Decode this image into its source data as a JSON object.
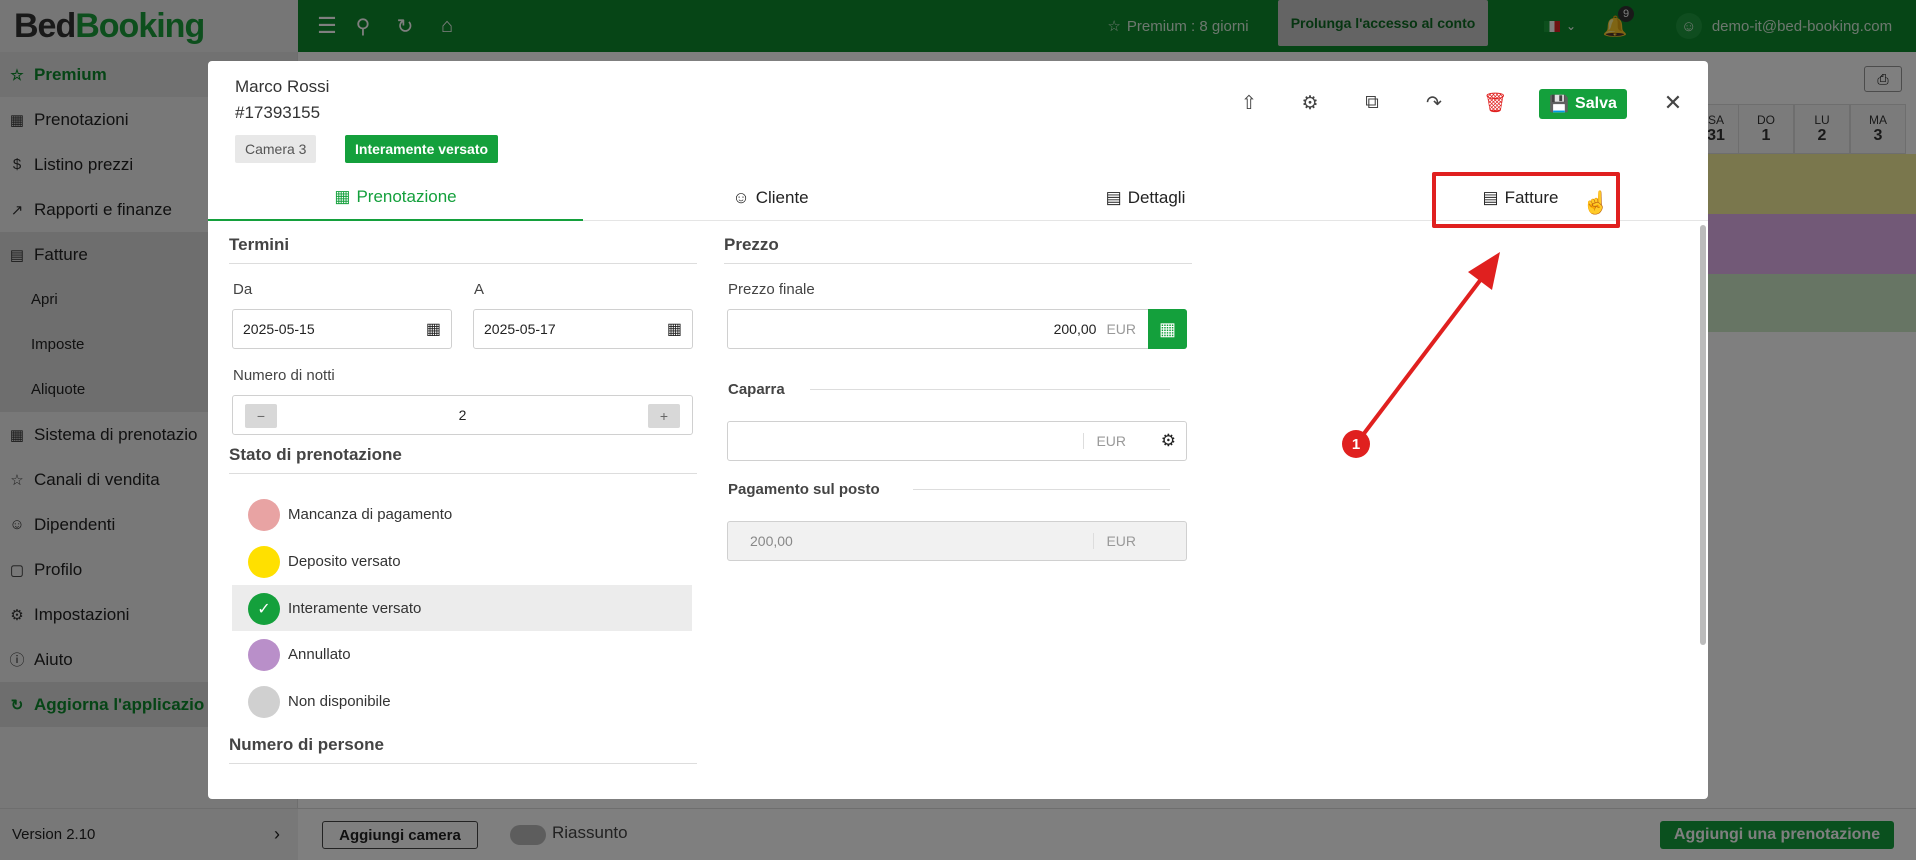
{
  "app": {
    "logo_part1": "Bed",
    "logo_part2": "Booking"
  },
  "topbar": {
    "premium_label": "Premium : 8 giorni",
    "extend_button": "Prolunga l'accesso al conto",
    "notifications_count": "9",
    "user_email": "demo-it@bed-booking.com"
  },
  "sidebar": {
    "items": [
      {
        "label": "Premium",
        "icon": "star-icon"
      },
      {
        "label": "Prenotazioni",
        "icon": "calendar-icon"
      },
      {
        "label": "Listino prezzi",
        "icon": "dollar-icon"
      },
      {
        "label": "Rapporti e finanze",
        "icon": "chart-icon"
      },
      {
        "label": "Fatture",
        "icon": "invoice-icon"
      },
      {
        "label": "Apri"
      },
      {
        "label": "Imposte"
      },
      {
        "label": "Aliquote"
      },
      {
        "label": "Sistema di prenotazio",
        "icon": "grid-icon"
      },
      {
        "label": "Canali di vendita",
        "icon": "star-outline-icon"
      },
      {
        "label": "Dipendenti",
        "icon": "user-plus-icon"
      },
      {
        "label": "Profilo",
        "icon": "building-icon"
      },
      {
        "label": "Impostazioni",
        "icon": "gear-icon"
      },
      {
        "label": "Aiuto",
        "icon": "info-icon"
      },
      {
        "label": "Aggiorna l'applicazio",
        "icon": "refresh-icon"
      }
    ],
    "version": "Version 2.10"
  },
  "calendar": {
    "days": [
      {
        "dow": "SA",
        "num": "31"
      },
      {
        "dow": "DO",
        "num": "1"
      },
      {
        "dow": "LU",
        "num": "2"
      },
      {
        "dow": "MA",
        "num": "3"
      }
    ]
  },
  "bottombar": {
    "add_room": "Aggiungi camera",
    "summary": "Riassunto",
    "add_booking": "Aggiungi una prenotazione"
  },
  "modal": {
    "guest_name": "Marco Rossi",
    "booking_id": "#17393155",
    "room_tag": "Camera 3",
    "status_tag": "Interamente versato",
    "save_label": "Salva",
    "tabs": [
      {
        "label": "Prenotazione"
      },
      {
        "label": "Cliente"
      },
      {
        "label": "Dettagli"
      },
      {
        "label": "Fatture"
      }
    ],
    "terms": {
      "title": "Termini",
      "from_label": "Da",
      "from_value": "2025-05-15",
      "to_label": "A",
      "to_value": "2025-05-17",
      "nights_label": "Numero di notti",
      "nights_value": "2"
    },
    "status_section": {
      "title": "Stato di prenotazione",
      "options": [
        {
          "label": "Mancanza di pagamento",
          "color": "#e8a3a3"
        },
        {
          "label": "Deposito versato",
          "color": "#ffe000"
        },
        {
          "label": "Interamente versato",
          "color": "#14a03c"
        },
        {
          "label": "Annullato",
          "color": "#b98fc9"
        },
        {
          "label": "Non disponibile",
          "color": "#d0d0d0"
        }
      ]
    },
    "persons_title": "Numero di persone",
    "price": {
      "title": "Prezzo",
      "final_label": "Prezzo finale",
      "final_value": "200,00",
      "currency": "EUR",
      "deposit_label": "Caparra",
      "deposit_value": "",
      "onsite_label": "Pagamento sul posto",
      "onsite_value": "200,00"
    }
  },
  "annotation": {
    "badge": "1"
  }
}
